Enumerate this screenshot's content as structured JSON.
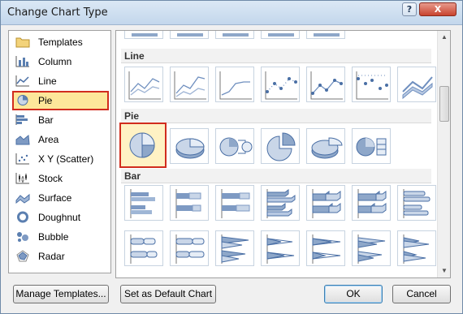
{
  "window": {
    "title": "Change Chart Type",
    "help_label": "?",
    "close_label": "X"
  },
  "categories": [
    {
      "label": "Templates",
      "icon": "folder-icon"
    },
    {
      "label": "Column",
      "icon": "column-chart-icon"
    },
    {
      "label": "Line",
      "icon": "line-chart-icon"
    },
    {
      "label": "Pie",
      "icon": "pie-chart-icon",
      "selected": true
    },
    {
      "label": "Bar",
      "icon": "bar-chart-icon"
    },
    {
      "label": "Area",
      "icon": "area-chart-icon"
    },
    {
      "label": "X Y (Scatter)",
      "icon": "scatter-chart-icon"
    },
    {
      "label": "Stock",
      "icon": "stock-chart-icon"
    },
    {
      "label": "Surface",
      "icon": "surface-chart-icon"
    },
    {
      "label": "Doughnut",
      "icon": "doughnut-chart-icon"
    },
    {
      "label": "Bubble",
      "icon": "bubble-chart-icon"
    },
    {
      "label": "Radar",
      "icon": "radar-chart-icon"
    }
  ],
  "gallery": {
    "sections": [
      {
        "title": "Line"
      },
      {
        "title": "Pie"
      },
      {
        "title": "Bar"
      }
    ]
  },
  "buttons": {
    "manage_templates": "Manage Templates...",
    "set_default": "Set as Default Chart",
    "ok": "OK",
    "cancel": "Cancel"
  }
}
